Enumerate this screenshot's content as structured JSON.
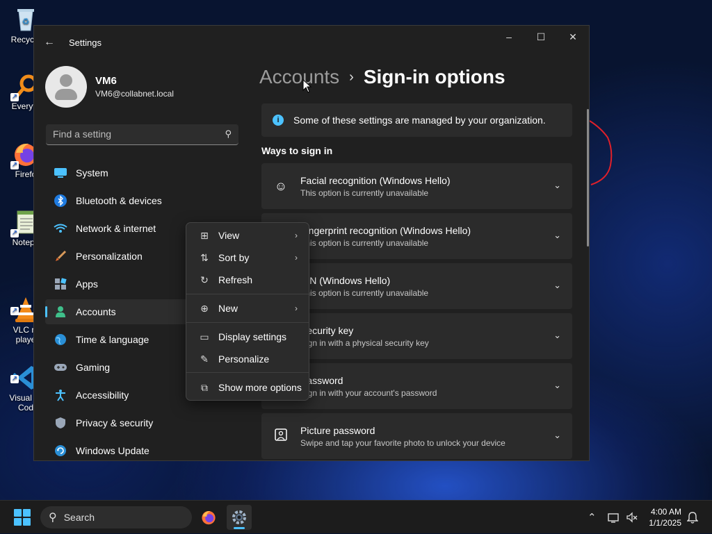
{
  "desktop": {
    "icons": [
      {
        "label": "Recycle",
        "icon": "recycle-bin-icon"
      },
      {
        "label": "Everyth",
        "icon": "everything-search-icon"
      },
      {
        "label": "Firefo",
        "icon": "firefox-icon"
      },
      {
        "label": "Notepa",
        "icon": "notepad-icon"
      },
      {
        "label": "VLC m\nplaye",
        "icon": "vlc-icon"
      },
      {
        "label": "Visual St\nCod",
        "icon": "vscode-icon"
      }
    ]
  },
  "window": {
    "title": "Settings",
    "controls": {
      "minimize": "–",
      "maximize": "☐",
      "close": "✕"
    }
  },
  "profile": {
    "name": "VM6",
    "email": "VM6@collabnet.local"
  },
  "search": {
    "placeholder": "Find a setting"
  },
  "nav": {
    "items": [
      {
        "label": "System",
        "icon": "system-icon"
      },
      {
        "label": "Bluetooth & devices",
        "icon": "bluetooth-icon"
      },
      {
        "label": "Network & internet",
        "icon": "wifi-icon"
      },
      {
        "label": "Personalization",
        "icon": "brush-icon"
      },
      {
        "label": "Apps",
        "icon": "apps-icon"
      },
      {
        "label": "Accounts",
        "icon": "accounts-icon",
        "active": true
      },
      {
        "label": "Time & language",
        "icon": "globe-icon"
      },
      {
        "label": "Gaming",
        "icon": "gamepad-icon"
      },
      {
        "label": "Accessibility",
        "icon": "accessibility-icon"
      },
      {
        "label": "Privacy & security",
        "icon": "shield-icon"
      },
      {
        "label": "Windows Update",
        "icon": "update-icon"
      }
    ]
  },
  "breadcrumb": {
    "parent": "Accounts",
    "separator": "›",
    "current": "Sign-in options"
  },
  "info_bar": {
    "text": "Some of these settings are managed by your organization."
  },
  "ways_heading": "Ways to sign in",
  "sign_in_options": [
    {
      "title": "Facial recognition (Windows Hello)",
      "subtitle": "This option is currently unavailable",
      "icon": "face-icon"
    },
    {
      "title": "Fingerprint recognition (Windows Hello)",
      "subtitle": "This option is currently unavailable",
      "icon": "fingerprint-icon"
    },
    {
      "title": "PIN (Windows Hello)",
      "subtitle": "This option is currently unavailable",
      "icon": "pin-icon"
    },
    {
      "title": "Security key",
      "subtitle": "Sign in with a physical security key",
      "icon": "key-icon"
    },
    {
      "title": "Password",
      "subtitle": "Sign in with your account's password",
      "icon": "password-icon"
    },
    {
      "title": "Picture password",
      "subtitle": "Swipe and tap your favorite photo to unlock your device",
      "icon": "picture-icon"
    }
  ],
  "context_menu": {
    "items": [
      {
        "label": "View",
        "icon": "view-grid-icon",
        "submenu": true
      },
      {
        "label": "Sort by",
        "icon": "sort-icon",
        "submenu": true
      },
      {
        "label": "Refresh",
        "icon": "refresh-icon",
        "submenu": false
      },
      {
        "label": "New",
        "icon": "new-plus-icon",
        "submenu": true
      },
      {
        "label": "Display settings",
        "icon": "display-icon",
        "submenu": false
      },
      {
        "label": "Personalize",
        "icon": "pen-icon",
        "submenu": false
      },
      {
        "label": "Show more options",
        "icon": "more-options-icon",
        "submenu": false
      }
    ]
  },
  "taskbar": {
    "search_label": "Search",
    "time": "4:00 AM",
    "date": "1/1/2025"
  },
  "colors": {
    "accent": "#4cc2ff",
    "window_bg": "#202020",
    "card_bg": "#2b2b2b",
    "annotation": "#e0202a"
  }
}
